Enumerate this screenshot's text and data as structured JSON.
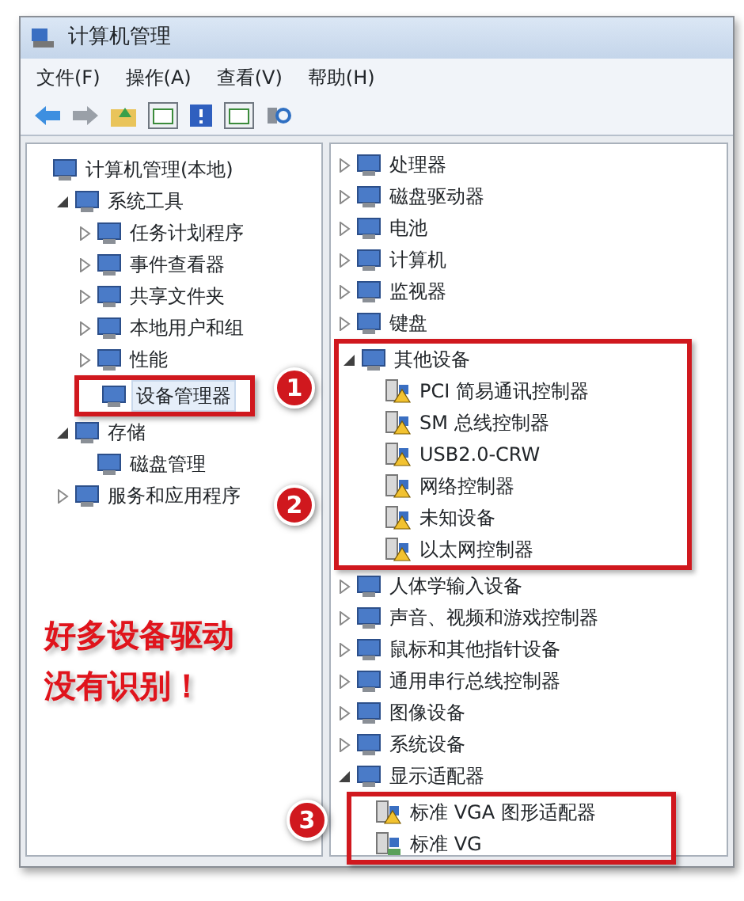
{
  "window": {
    "title": "计算机管理"
  },
  "menu": [
    "文件(F)",
    "操作(A)",
    "查看(V)",
    "帮助(H)"
  ],
  "left_tree": [
    {
      "label": "计算机管理(本地)",
      "selected": false,
      "children": [
        {
          "label": "系统工具",
          "expanded": true,
          "selected": false,
          "children": [
            {
              "label": "任务计划程序",
              "expanded": false,
              "selected": false
            },
            {
              "label": "事件查看器",
              "expanded": false,
              "selected": false
            },
            {
              "label": "共享文件夹",
              "expanded": false,
              "selected": false
            },
            {
              "label": "本地用户和组",
              "expanded": false,
              "selected": false
            },
            {
              "label": "性能",
              "expanded": false,
              "selected": false
            },
            {
              "label": "设备管理器",
              "selected": true,
              "boxed": true
            }
          ]
        },
        {
          "label": "存储",
          "expanded": true,
          "selected": false,
          "children": [
            {
              "label": "磁盘管理",
              "selected": false
            }
          ]
        },
        {
          "label": "服务和应用程序",
          "expanded": false,
          "selected": false
        }
      ]
    }
  ],
  "right_tree": [
    {
      "label": "处理器",
      "expanded": false,
      "selected": false
    },
    {
      "label": "磁盘驱动器",
      "expanded": false,
      "selected": false
    },
    {
      "label": "电池",
      "expanded": false,
      "selected": false
    },
    {
      "label": "计算机",
      "expanded": false,
      "selected": false
    },
    {
      "label": "监视器",
      "expanded": false,
      "selected": false
    },
    {
      "label": "键盘",
      "expanded": false,
      "selected": false
    },
    {
      "label": "其他设备",
      "expanded": true,
      "selected": false,
      "boxed": true,
      "children": [
        {
          "label": "PCI 简易通讯控制器",
          "warning": true,
          "selected": false
        },
        {
          "label": "SM 总线控制器",
          "warning": true,
          "selected": false
        },
        {
          "label": "USB2.0-CRW",
          "warning": true,
          "selected": false
        },
        {
          "label": "网络控制器",
          "warning": true,
          "selected": false
        },
        {
          "label": "未知设备",
          "warning": true,
          "selected": false
        },
        {
          "label": "以太网控制器",
          "warning": true,
          "selected": false
        }
      ]
    },
    {
      "label": "人体学输入设备",
      "expanded": false,
      "selected": false
    },
    {
      "label": "声音、视频和游戏控制器",
      "expanded": false,
      "selected": false
    },
    {
      "label": "鼠标和其他指针设备",
      "expanded": false,
      "selected": false
    },
    {
      "label": "通用串行总线控制器",
      "expanded": false,
      "selected": false
    },
    {
      "label": "图像设备",
      "expanded": false,
      "selected": false
    },
    {
      "label": "系统设备",
      "expanded": false,
      "selected": false
    },
    {
      "label": "显示适配器",
      "expanded": true,
      "selected": false,
      "children_boxed": true,
      "children": [
        {
          "label": "标准 VGA 图形适配器",
          "warning": true,
          "selected": false
        },
        {
          "label": "标准 VG",
          "warning": false,
          "selected": false
        }
      ]
    }
  ],
  "callouts": [
    "1",
    "2",
    "3"
  ],
  "note": [
    "好多设备驱动",
    "没有识别！"
  ]
}
